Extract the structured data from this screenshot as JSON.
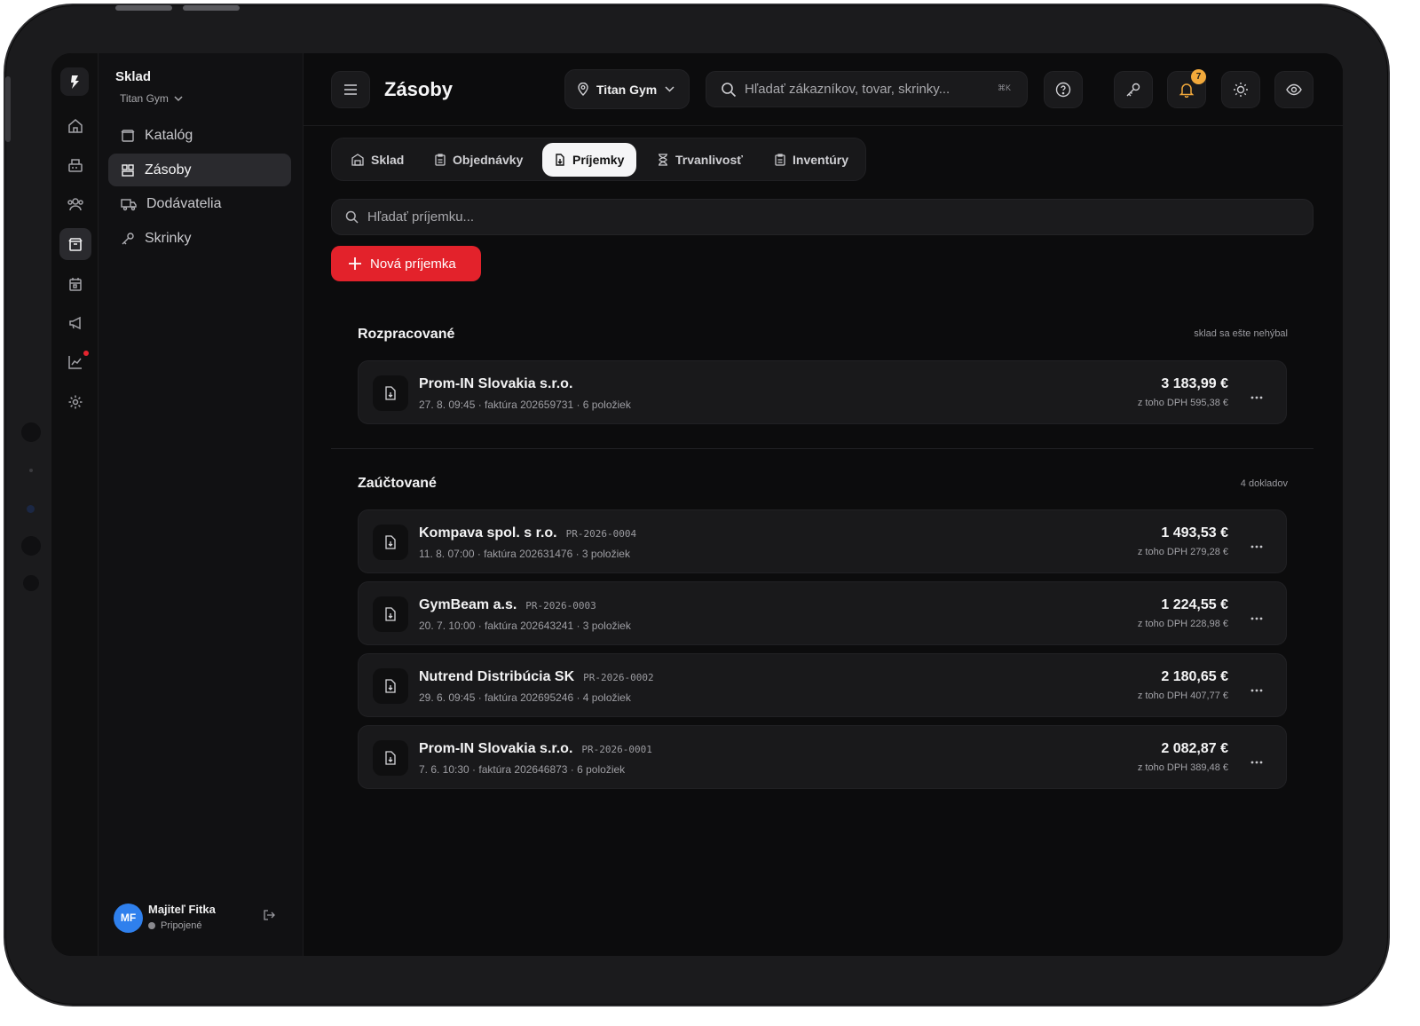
{
  "app": {
    "section_title": "Sklad",
    "org_name": "Titan Gym",
    "page_title": "Zásoby"
  },
  "sidebar": {
    "items": [
      {
        "label": "Katalóg",
        "icon": "catalog-icon",
        "active": false
      },
      {
        "label": "Zásoby",
        "icon": "stock-icon",
        "active": true
      },
      {
        "label": "Dodávatelia",
        "icon": "truck-icon",
        "active": false
      },
      {
        "label": "Skrinky",
        "icon": "key-icon",
        "active": false
      }
    ]
  },
  "rail": {
    "icons": [
      "home-icon",
      "cash-register-icon",
      "users-icon",
      "box-icon",
      "calendar-icon",
      "megaphone-icon",
      "chart-icon",
      "settings-icon"
    ]
  },
  "user": {
    "initials": "MF",
    "name": "Majiteľ Fitka",
    "status": "Pripojené"
  },
  "topbar": {
    "location": "Titan Gym",
    "search_placeholder": "Hľadať zákazníkov, tovar, skrinky...",
    "shortcut": "⌘K",
    "notifications_count": "7"
  },
  "tabs": [
    {
      "label": "Sklad",
      "icon": "warehouse-icon",
      "active": false
    },
    {
      "label": "Objednávky",
      "icon": "clipboard-icon",
      "active": false
    },
    {
      "label": "Príjemky",
      "icon": "receipt-icon",
      "active": true
    },
    {
      "label": "Trvanlivosť",
      "icon": "hourglass-icon",
      "active": false
    },
    {
      "label": "Inventúry",
      "icon": "clipboard-check-icon",
      "active": false
    }
  ],
  "list": {
    "search_placeholder": "Hľadať príjemku...",
    "new_button": "Nová príjemka"
  },
  "sections": {
    "draft": {
      "title": "Rozpracované",
      "note": "sklad sa ešte nehýbal",
      "items": [
        {
          "supplier": "Prom-IN Slovakia s.r.o.",
          "code": "",
          "meta": "27. 8. 09:45 · faktúra 202659731 · 6 položiek",
          "amount": "3 183,99 €",
          "vat": "z toho DPH 595,38 €"
        }
      ]
    },
    "posted": {
      "title": "Zaúčtované",
      "note": "4 dokladov",
      "items": [
        {
          "supplier": "Kompava spol. s r.o.",
          "code": "PR-2026-0004",
          "meta": "11. 8. 07:00 · faktúra 202631476 · 3 položiek",
          "amount": "1 493,53 €",
          "vat": "z toho DPH 279,28 €"
        },
        {
          "supplier": "GymBeam a.s.",
          "code": "PR-2026-0003",
          "meta": "20. 7. 10:00 · faktúra 202643241 · 3 položiek",
          "amount": "1 224,55 €",
          "vat": "z toho DPH 228,98 €"
        },
        {
          "supplier": "Nutrend Distribúcia SK",
          "code": "PR-2026-0002",
          "meta": "29. 6. 09:45 · faktúra 202695246 · 4 položiek",
          "amount": "2 180,65 €",
          "vat": "z toho DPH 407,77 €"
        },
        {
          "supplier": "Prom-IN Slovakia s.r.o.",
          "code": "PR-2026-0001",
          "meta": "7. 6. 10:30 · faktúra 202646873 · 6 položiek",
          "amount": "2 082,87 €",
          "vat": "z toho DPH 389,48 €"
        }
      ]
    }
  },
  "colors": {
    "accent": "#e3222b",
    "badge": "#f2a93b",
    "avatar": "#2f80ed",
    "background": "#0c0c0d"
  }
}
